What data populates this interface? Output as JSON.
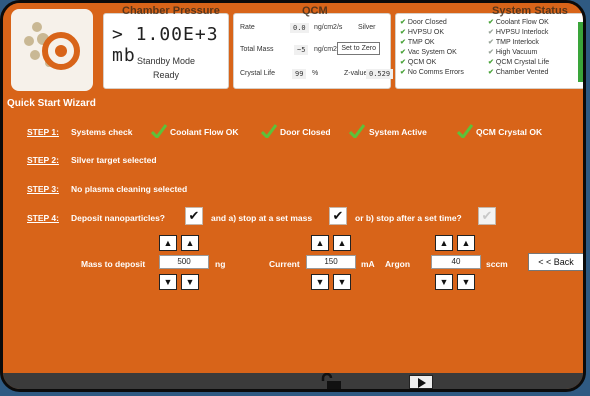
{
  "header": {
    "pressure": {
      "section_label": "Chamber Pressure",
      "reading": "> 1.00E+3 mb",
      "mode": "Standby Mode",
      "state": "Ready"
    },
    "qcm": {
      "section_label": "QCM",
      "rate_label": "Rate",
      "rate_value": "0.0",
      "rate_unit": "ng/cm2/s",
      "material": "Silver",
      "total_mass_label": "Total Mass",
      "total_mass_value": "~5",
      "total_mass_unit": "ng/cm2",
      "set_zero_label": "Set to Zero",
      "crystal_life_label": "Crystal Life",
      "crystal_life_value": "99",
      "crystal_life_unit": "%",
      "zvalue_label": "Z-value",
      "zvalue_value": "0.529"
    },
    "status": {
      "section_label": "System Status",
      "col1": [
        {
          "label": "Door Closed",
          "ok": true
        },
        {
          "label": "HVPSU OK",
          "ok": true
        },
        {
          "label": "TMP OK",
          "ok": true
        },
        {
          "label": "Vac System OK",
          "ok": true
        },
        {
          "label": "QCM OK",
          "ok": true
        },
        {
          "label": "No Comms Errors",
          "ok": true
        }
      ],
      "col2": [
        {
          "label": "Coolant Flow OK",
          "ok": true
        },
        {
          "label": "HVPSU Interlock",
          "ok": false
        },
        {
          "label": "TMP Interlock",
          "ok": false
        },
        {
          "label": "High Vacuum",
          "ok": false
        },
        {
          "label": "QCM Crystal Life",
          "ok": true
        },
        {
          "label": "Chamber Vented",
          "ok": true
        }
      ]
    }
  },
  "wizard": {
    "title": "Quick Start Wizard",
    "step1": {
      "label": "STEP 1:",
      "text": "Systems check",
      "checks": [
        "Coolant Flow OK",
        "Door Closed",
        "System Active",
        "QCM Crystal OK"
      ]
    },
    "step2": {
      "label": "STEP 2:",
      "text": "Silver target selected"
    },
    "step3": {
      "label": "STEP 3:",
      "text": "No plasma cleaning selected"
    },
    "step4": {
      "label": "STEP 4:",
      "text": "Deposit nanoparticles?",
      "and_a": "and a) stop at a set mass",
      "or_b": "or b) stop after a set time?",
      "deposit_checked": true,
      "set_mass_checked": true,
      "set_time_checked": false
    },
    "params": {
      "mass_label": "Mass to deposit",
      "mass_value": "500",
      "mass_unit": "ng",
      "current_label": "Current",
      "current_value": "150",
      "current_unit": "mA",
      "argon_label": "Argon",
      "argon_value": "40",
      "argon_unit": "sccm"
    },
    "back_label": "< < Back"
  },
  "icons": {
    "check": "check-icon",
    "arrow_up": "arrow-up-icon",
    "arrow_down": "arrow-down-icon",
    "lock": "lock-icon",
    "play": "play-icon",
    "logo": "logo-icon"
  },
  "colors": {
    "accent": "#d86419",
    "ok": "#4aa33a"
  }
}
